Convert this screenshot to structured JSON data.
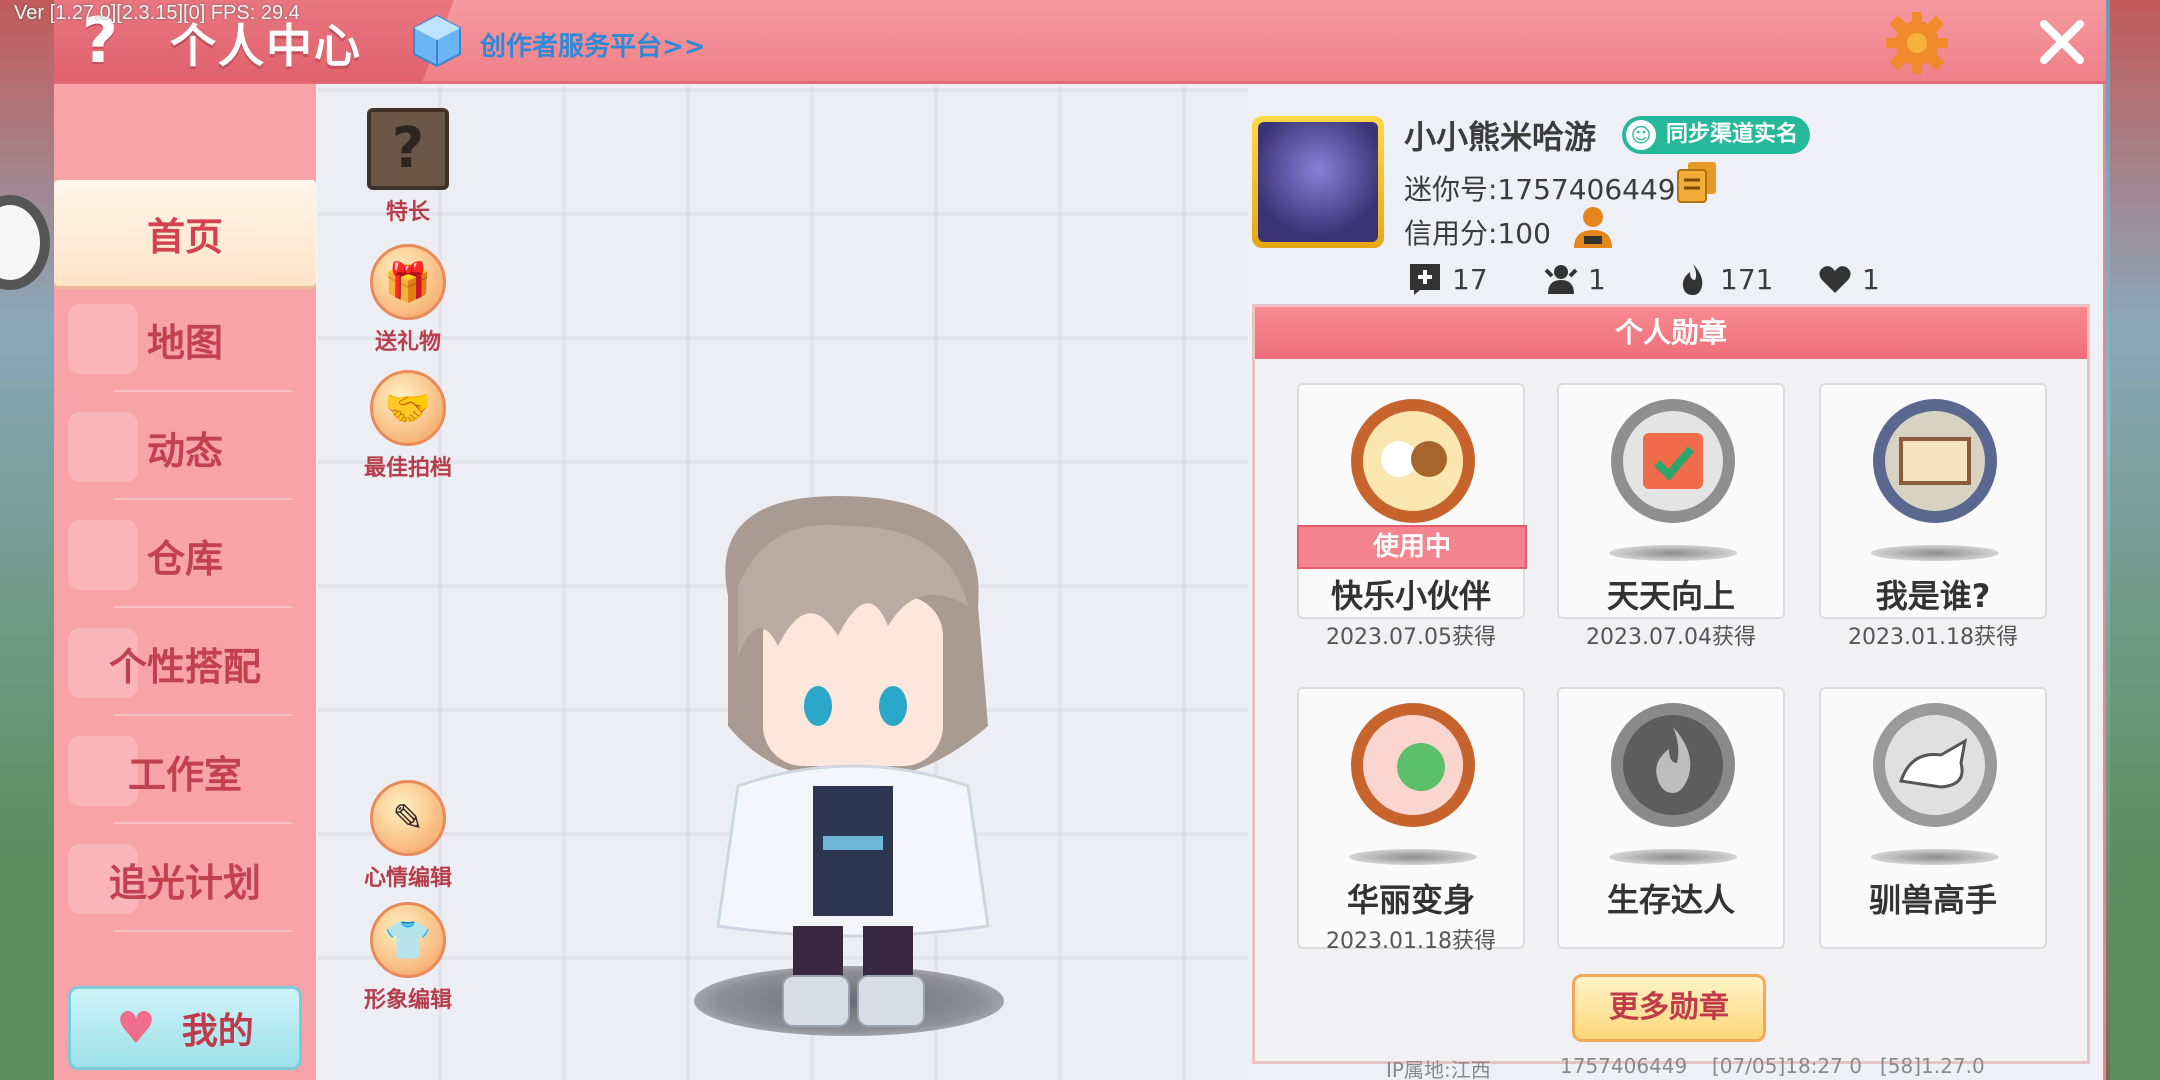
{
  "debug": {
    "version_text": "Ver [1.27.0][2.3.15][0] FPS: 29.4"
  },
  "header": {
    "title": "个人中心",
    "platform_link": "创作者服务平台>>"
  },
  "menu": {
    "items": [
      {
        "label": "首页",
        "active": true
      },
      {
        "label": "地图"
      },
      {
        "label": "动态"
      },
      {
        "label": "仓库"
      },
      {
        "label": "个性搭配"
      },
      {
        "label": "工作室"
      },
      {
        "label": "追光计划"
      }
    ],
    "my_button": "我的"
  },
  "side_buttons": {
    "specialty": "特长",
    "gift": "送礼物",
    "partner": "最佳拍档",
    "mood_edit": "心情编辑",
    "look_edit": "形象编辑"
  },
  "profile": {
    "nickname": "小小熊米哈游",
    "sync_badge": "同步渠道实名",
    "mini_id": "迷你号:1757406449",
    "credit": "信用分:100",
    "stats": {
      "posts": "17",
      "followers": "1",
      "popularity": "171",
      "likes": "1"
    }
  },
  "medals": {
    "header": "个人勋章",
    "using_label": "使用中",
    "items": [
      {
        "name": "快乐小伙伴",
        "date": "2023.07.05获得"
      },
      {
        "name": "天天向上",
        "date": "2023.07.04获得"
      },
      {
        "name": "我是谁?",
        "date": "2023.01.18获得"
      },
      {
        "name": "华丽变身",
        "date": "2023.01.18获得"
      },
      {
        "name": "生存达人",
        "date": ""
      },
      {
        "name": "驯兽高手",
        "date": ""
      }
    ],
    "more_button": "更多勋章"
  },
  "footer": {
    "ip": "IP属地:江西",
    "id": "1757406449",
    "time": "[07/05]18:27 0",
    "build": "[58]1.27.0"
  },
  "colors": {
    "accent": "#ef8088",
    "menu_text": "#c2414e",
    "badge_green": "#25b89b"
  }
}
